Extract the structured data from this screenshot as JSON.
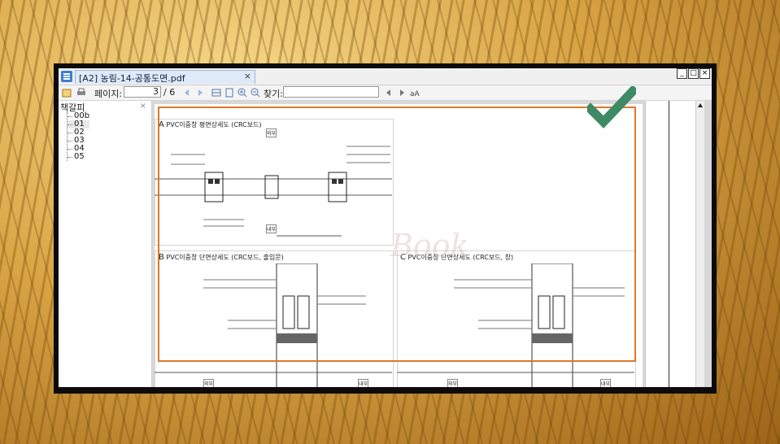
{
  "window": {
    "tab_title": "[A2] 농림-14-공통도면.pdf",
    "tab_close": "×",
    "controls": [
      "_",
      "□",
      "×"
    ]
  },
  "toolbar": {
    "page_label": "페이지:",
    "page_current": "3",
    "page_separator": "/ 6",
    "find_label": "찾기:",
    "find_value": ""
  },
  "sidebar": {
    "title": "책갈피",
    "close": "×",
    "items": [
      "00b",
      "01",
      "02",
      "03",
      "04",
      "05"
    ],
    "selected": "01"
  },
  "document": {
    "sections": [
      {
        "letter": "A",
        "title": "PVC이중창 평면상세도 (CRC보드)"
      },
      {
        "letter": "B",
        "title": "PVC이중창 단면상세도 (CRC보드, 출입문)"
      },
      {
        "letter": "C",
        "title": "PVC이중창 단면상세도 (CRC보드, 창)"
      }
    ],
    "tags": [
      "외부",
      "내부",
      "외부",
      "내부",
      "외부",
      "내부"
    ]
  },
  "colors": {
    "highlight": "#e0782a",
    "check": "#3f8a66",
    "tab_bg": "#dfeaf8",
    "accent": "#3c7fd1"
  }
}
